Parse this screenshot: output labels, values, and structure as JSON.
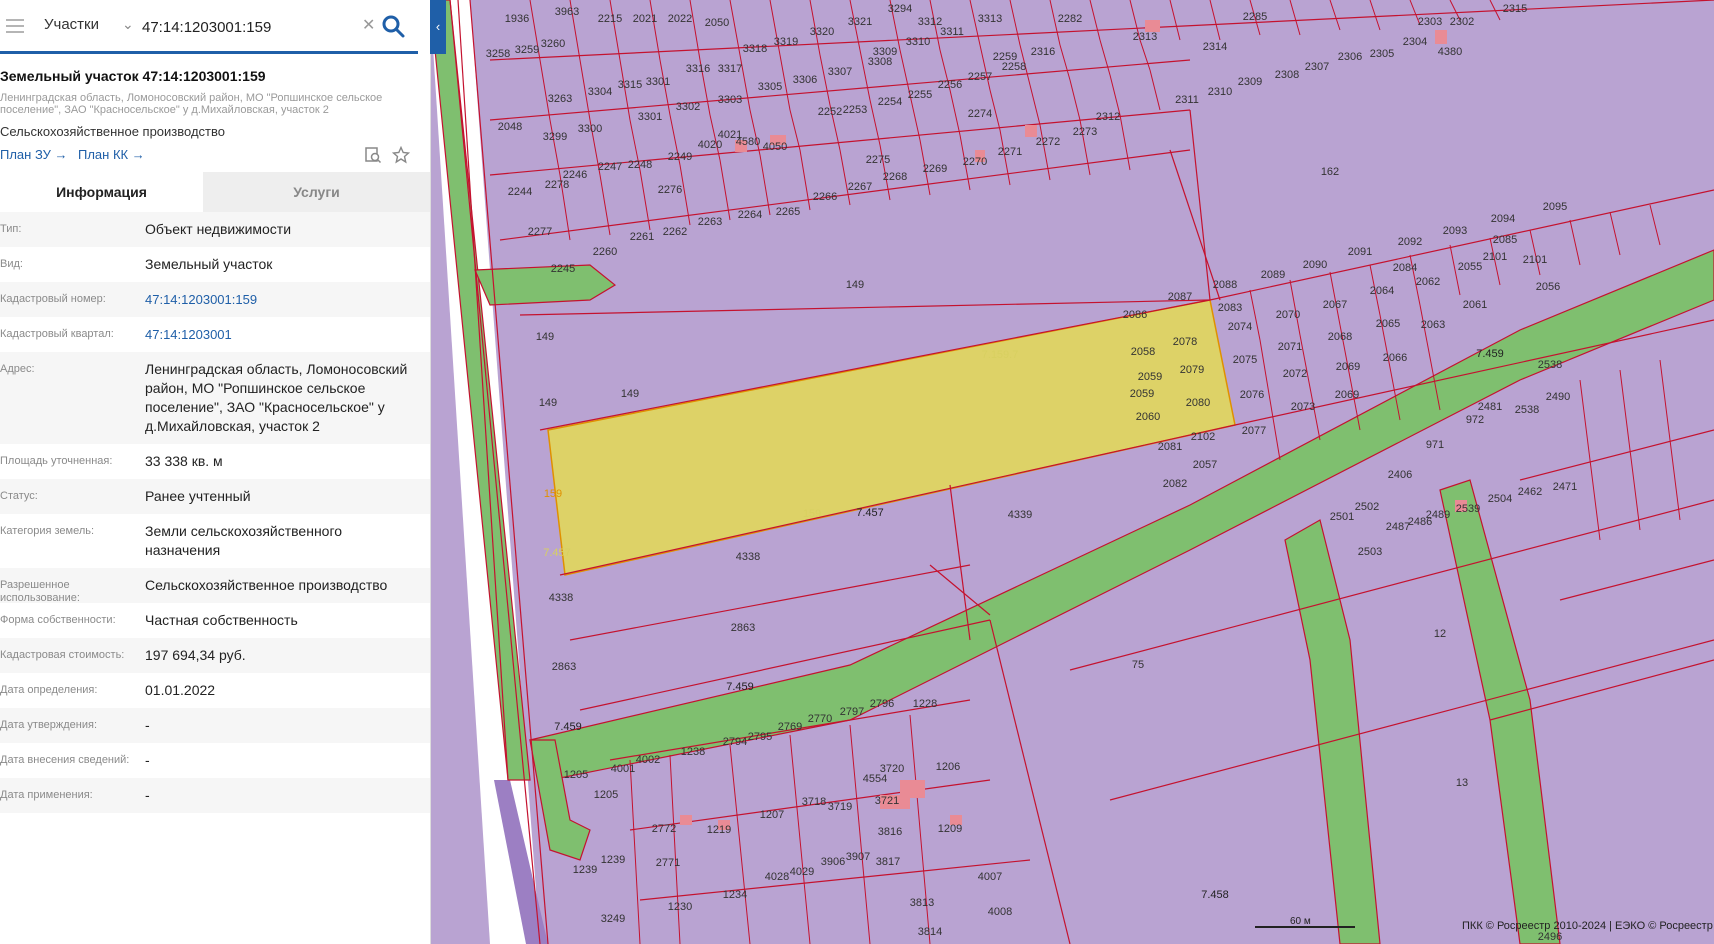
{
  "search": {
    "type_label": "Участки",
    "query": "47:14:1203001:159"
  },
  "object": {
    "title": "Земельный участок 47:14:1203001:159",
    "address_short": "Ленинградская область, Ломоносовский район, МО \"Ропшинское сельское поселение\", ЗАО \"Красносельское\" у д.Михайловская, участок 2",
    "use": "Сельскохозяйственное производство",
    "plan_zu": "План ЗУ →",
    "plan_kk": "План КК →"
  },
  "tabs": {
    "info": "Информация",
    "services": "Услуги"
  },
  "rows": [
    {
      "label": "Тип:",
      "value": "Объект недвижимости"
    },
    {
      "label": "Вид:",
      "value": "Земельный участок"
    },
    {
      "label": "Кадастровый номер:",
      "value": "47:14:1203001:159"
    },
    {
      "label": "Кадастровый квартал:",
      "value": "47:14:1203001"
    },
    {
      "label": "Адрес:",
      "value": "Ленинградская область, Ломоносовский район, МО \"Ропшинское сельское поселение\", ЗАО \"Красносельское\" у д.Михайловская, участок 2"
    },
    {
      "label": "Площадь уточненная:",
      "value": "33 338 кв. м"
    },
    {
      "label": "Статус:",
      "value": "Ранее учтенный"
    },
    {
      "label": "Категория земель:",
      "value": "Земли сельскохозяйственного назначения"
    },
    {
      "label": "Разрешенное использование:",
      "value": "Сельскохозяйственное производство"
    },
    {
      "label": "Форма собственности:",
      "value": "Частная собственность"
    },
    {
      "label": "Кадастровая стоимость:",
      "value": "197 694,34 руб."
    },
    {
      "label": "Дата определения:",
      "value": "01.01.2022"
    },
    {
      "label": "Дата утверждения:",
      "value": "-"
    },
    {
      "label": "Дата внесения сведений:",
      "value": "-"
    },
    {
      "label": "Дата применения:",
      "value": "-"
    }
  ],
  "map": {
    "scale": "60 м",
    "copyright": "ПКК © Росреестр 2010-2024 | ЕЭКО © Росреестр",
    "colors": {
      "parcel": "#b9a3d2",
      "selected": "#ddd267",
      "road": "#7fbf6f",
      "border": "#c4122f"
    },
    "labels": [
      "1936",
      "3963",
      "2215",
      "2021",
      "2022",
      "2050",
      "3318",
      "3319",
      "3320",
      "3321",
      "3294",
      "3312",
      "3313",
      "2282",
      "2285",
      "2315",
      "2303",
      "2302",
      "3258",
      "3259",
      "3260",
      "3317",
      "3316",
      "3309",
      "3310",
      "3311",
      "2259",
      "2316",
      "2313",
      "2314",
      "2311",
      "2310",
      "2309",
      "2308",
      "2307",
      "2306",
      "2305",
      "2304",
      "4380",
      "3263",
      "3304",
      "3315",
      "3301",
      "3302",
      "3303",
      "3305",
      "3306",
      "3307",
      "3308",
      "2252",
      "2253",
      "2254",
      "2255",
      "2256",
      "2257",
      "2258",
      "2048",
      "3299",
      "3300",
      "4021",
      "4020",
      "4050",
      "2249",
      "2248",
      "2247",
      "2246",
      "2245",
      "2244",
      "2278",
      "2274",
      "2275",
      "2276",
      "2277",
      "2273",
      "2272",
      "2271",
      "2270",
      "2269",
      "2268",
      "2267",
      "2266",
      "2265",
      "2264",
      "2263",
      "2262",
      "2261",
      "2260",
      "2312",
      "162",
      "149",
      "2086",
      "2087",
      "2088",
      "2089",
      "2090",
      "2091",
      "2092",
      "2093",
      "2094",
      "2095",
      "2085",
      "2084",
      "2083",
      "2078",
      "2079",
      "2080",
      "2081",
      "2082",
      "2058",
      "2059",
      "2060",
      "2074",
      "2075",
      "2076",
      "2077",
      "2070",
      "2071",
      "2072",
      "2073",
      "2067",
      "2068",
      "2069",
      "2064",
      "2065",
      "2066",
      "2062",
      "2063",
      "2055",
      "2061",
      "2101",
      "2056",
      "7.459",
      "159",
      "7.457",
      "4338",
      "4339",
      "2863",
      "2102",
      "2057",
      "972",
      "971",
      "2406",
      "2501",
      "2502",
      "2503",
      "2487",
      "2486",
      "2489",
      "2539",
      "2504",
      "2462",
      "2471",
      "12",
      "75",
      "13",
      "7.458",
      "1228",
      "1206",
      "1209",
      "4007",
      "4008",
      "2796",
      "2797",
      "2770",
      "2769",
      "2795",
      "2794",
      "1238",
      "4002",
      "4001",
      "1205",
      "3720",
      "4554",
      "3721",
      "3816",
      "3817",
      "3719",
      "3718",
      "1207",
      "1219",
      "2772",
      "2771",
      "1230",
      "1234",
      "4028",
      "4029",
      "3906",
      "3907",
      "3813",
      "3814",
      "3249",
      "1239",
      "2538",
      "2481",
      "3538",
      "2496"
    ]
  }
}
